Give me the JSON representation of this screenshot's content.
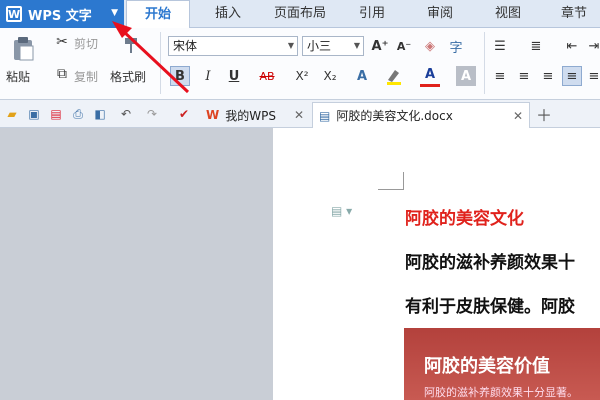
{
  "app": {
    "name": "WPS 文字",
    "logo": "W"
  },
  "ribbon_tabs": [
    "开始",
    "插入",
    "页面布局",
    "引用",
    "审阅",
    "视图",
    "章节"
  ],
  "clipboard": {
    "paste": "粘贴",
    "cut": "剪切",
    "copy": "复制",
    "format_painter": "格式刷"
  },
  "font": {
    "family": "宋体",
    "size": "小三"
  },
  "format_buttons": {
    "bold": "B",
    "italic": "I",
    "underline": "U",
    "strike": "AB",
    "superscript": "X²",
    "subscript": "X₂",
    "grow": "A⁺",
    "shrink": "A⁻",
    "color": "A"
  },
  "doc_tabs": [
    {
      "label": "我的WPS"
    },
    {
      "label": "阿胶的美容文化.docx"
    }
  ],
  "document": {
    "title": "阿胶的美容文化",
    "lines": [
      "阿胶的滋补养颜效果十",
      "有利于皮肤保健。阿胶"
    ],
    "image_title": "阿胶的美容价值",
    "image_sub": "阿胶的滋补养颜效果十分显著。"
  },
  "colors": {
    "accent": "#2c78cf",
    "title_red": "#e0221c",
    "arrow": "#e8101e"
  }
}
